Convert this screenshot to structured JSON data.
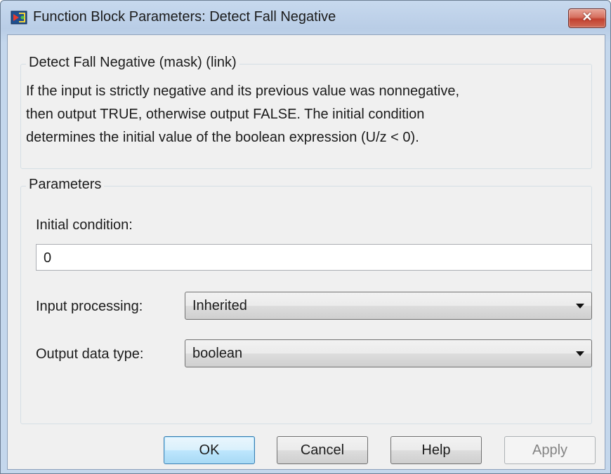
{
  "window": {
    "title": "Function Block Parameters: Detect Fall Negative",
    "close_glyph": "✕"
  },
  "description_group": {
    "legend": "Detect Fall Negative (mask) (link)",
    "lines": [
      "If the input is strictly negative and its previous value was nonnegative,",
      "then output TRUE, otherwise output FALSE.  The initial condition",
      "determines the initial value of the boolean expression (U/z < 0)."
    ]
  },
  "parameters_group": {
    "legend": "Parameters",
    "initial_condition": {
      "label": "Initial condition:",
      "value": "0"
    },
    "input_processing": {
      "label": "Input processing:",
      "selected": "Inherited"
    },
    "output_data_type": {
      "label": "Output data type:",
      "selected": "boolean"
    }
  },
  "buttons": {
    "ok": "OK",
    "cancel": "Cancel",
    "help": "Help",
    "apply": "Apply"
  },
  "colors": {
    "accent": "#3c7fb1",
    "close": "#c24130"
  },
  "icons": {
    "title": "simulink-block-icon",
    "dropdown": "chevron-down-icon"
  }
}
